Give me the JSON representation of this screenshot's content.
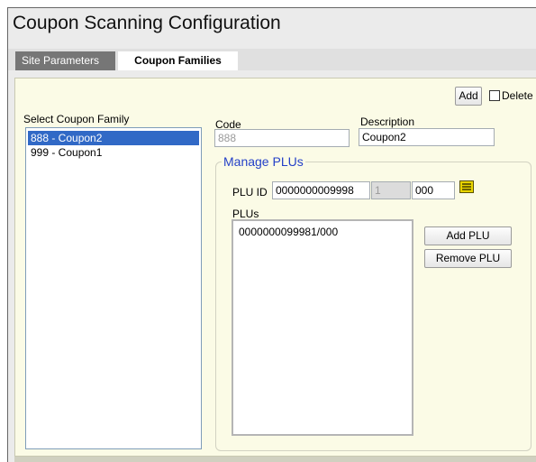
{
  "window": {
    "title": "Coupon Scanning Configuration"
  },
  "tabs": [
    {
      "label": "Site Parameters"
    },
    {
      "label": "Coupon Families"
    }
  ],
  "toolbar": {
    "add_label": "Add",
    "delete_label": "Delete",
    "delete_checked": false
  },
  "families": {
    "label": "Select Coupon Family",
    "items": [
      {
        "label": "888 - Coupon2",
        "selected": true
      },
      {
        "label": "999 - Coupon1",
        "selected": false
      }
    ]
  },
  "details": {
    "code_label": "Code",
    "code_value": "888",
    "description_label": "Description",
    "description_value": "Coupon2"
  },
  "plus": {
    "legend": "Manage PLUs",
    "plu_id_label": "PLU ID",
    "plu_id_value": "0000000009998",
    "check_digit_value": "1",
    "suffix_value": "000",
    "list_label": "PLUs",
    "items": [
      "0000000099981/000"
    ],
    "add_label": "Add PLU",
    "remove_label": "Remove PLU"
  },
  "colors": {
    "selected": "#3169c6",
    "panel": "#fbfbe6",
    "legend": "#2440c8",
    "lookup_icon": "#e8d400"
  }
}
